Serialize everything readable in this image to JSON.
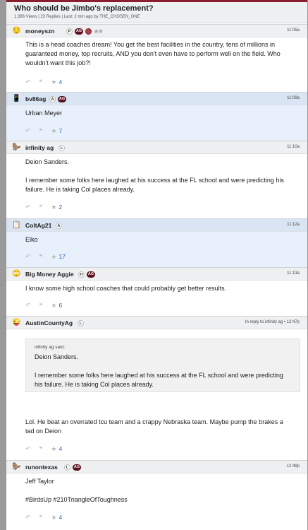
{
  "thread": {
    "title": "Who should be Jimbo's replacement?",
    "meta": "1,366 Views | 23 Replies | Last: 2 min ago by THE_CHOSEN_ONE"
  },
  "posts": [
    {
      "avatar": "😌",
      "avatar_icon": "relieved-face-icon",
      "username": "moneyszn",
      "badges": [
        "P",
        "AG",
        "ring",
        "★★"
      ],
      "time": "11:05a",
      "paragraphs": [
        "This is a head coaches dream! You get the best facilities in the country, tens of millions in guaranteed money, top recruits, AND you don't even have to perform well on the field. Who wouldn't want this job?!"
      ],
      "stars": "4"
    },
    {
      "avatar": "📱",
      "avatar_icon": "phone-icon",
      "username": "bv86ag",
      "badges": [
        "A",
        "AG"
      ],
      "time": "11:09a",
      "paragraphs": [
        "Urban Meyer"
      ],
      "stars": "7"
    },
    {
      "avatar": "🦫",
      "avatar_icon": "animal-icon",
      "username": "infinity ag",
      "badges": [
        "L"
      ],
      "time": "11:10a",
      "paragraphs": [
        "Deion Sanders.",
        "I remember some folks here laughed at his success at the FL school and were predicting his failure. He is taking Col places already."
      ],
      "stars": "2"
    },
    {
      "avatar": "📋",
      "avatar_icon": "document-icon",
      "username": "ColtAg21",
      "badges": [
        "A"
      ],
      "time": "11:12a",
      "paragraphs": [
        "Elko"
      ],
      "stars": "17"
    },
    {
      "avatar": "🙄",
      "avatar_icon": "eye-roll-face-icon",
      "username": "Big Money Aggie",
      "badges": [
        "H",
        "AG"
      ],
      "time": "11:13a",
      "paragraphs": [
        "I know some high school coaches that could probably get better results."
      ],
      "stars": "6"
    },
    {
      "avatar": "😜",
      "avatar_icon": "winking-face-icon",
      "username": "AustinCountyAg",
      "badges": [
        "L"
      ],
      "time": "In reply to infinity ag • 12:47p",
      "quote": {
        "header": "infinity ag said:",
        "paragraphs": [
          "Deion Sanders.",
          "I remember some folks here laughed at his success at the FL school and were predicting his failure. He is taking Col places already."
        ]
      },
      "paragraphs": [
        "Lol. He beat an overrated tcu team and a crappy Nebraska team. Maybe pump the brakes a tad on Deion"
      ],
      "stars": "4"
    },
    {
      "avatar": "🦫",
      "avatar_icon": "animal-icon",
      "username": "runontexas",
      "badges": [
        "L",
        "AG"
      ],
      "time": "12:49p",
      "paragraphs": [
        "Jeff Taylor",
        "#BirdsUp #210TriangleOfToughness"
      ],
      "stars": "4"
    }
  ],
  "actions": {
    "reply_icon": "↶",
    "quote_icon": "❝",
    "star_icon": "★"
  },
  "colors": {
    "accent": "#5c0f1d",
    "link": "#2f64b3",
    "highlight": "#e7f0fb"
  }
}
